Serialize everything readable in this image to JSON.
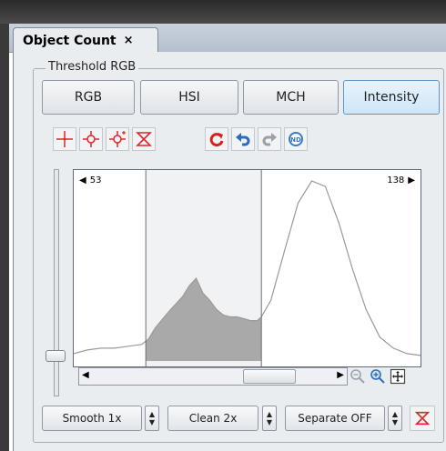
{
  "tab": {
    "title": "Object Count",
    "close_glyph": "×"
  },
  "group": {
    "title": "Threshold RGB"
  },
  "modes": [
    {
      "label": "RGB",
      "active": false
    },
    {
      "label": "HSI",
      "active": false
    },
    {
      "label": "MCH",
      "active": false
    },
    {
      "label": "Intensity",
      "active": true
    }
  ],
  "tools": [
    "crosshair-icon",
    "pick-color-icon",
    "pick-color-add-icon",
    "clear-threshold-icon",
    "refresh-icon",
    "undo-icon",
    "redo-icon",
    "nd-icon"
  ],
  "histogram": {
    "low_value": "53",
    "high_value": "138",
    "selection": {
      "low": 53,
      "high": 138
    },
    "x_range": [
      0,
      255
    ]
  },
  "chart_data": {
    "type": "area",
    "x_range": [
      0,
      255
    ],
    "x": [
      0,
      10,
      20,
      30,
      40,
      50,
      55,
      60,
      70,
      80,
      85,
      90,
      95,
      100,
      105,
      110,
      115,
      120,
      125,
      130,
      135,
      138,
      145,
      155,
      165,
      175,
      185,
      195,
      205,
      215,
      225,
      235,
      245,
      255
    ],
    "y": [
      4,
      6,
      7,
      7,
      8,
      9,
      12,
      18,
      27,
      35,
      41,
      45,
      37,
      33,
      28,
      25,
      24,
      24,
      23,
      22,
      22,
      24,
      33,
      60,
      86,
      98,
      95,
      75,
      50,
      28,
      13,
      7,
      4,
      3
    ],
    "selection_range": [
      53,
      138
    ],
    "grid": false
  },
  "bottom": {
    "smooth_label": "Smooth 1x",
    "clean_label": "Clean 2x",
    "separate_label": "Separate OFF"
  }
}
